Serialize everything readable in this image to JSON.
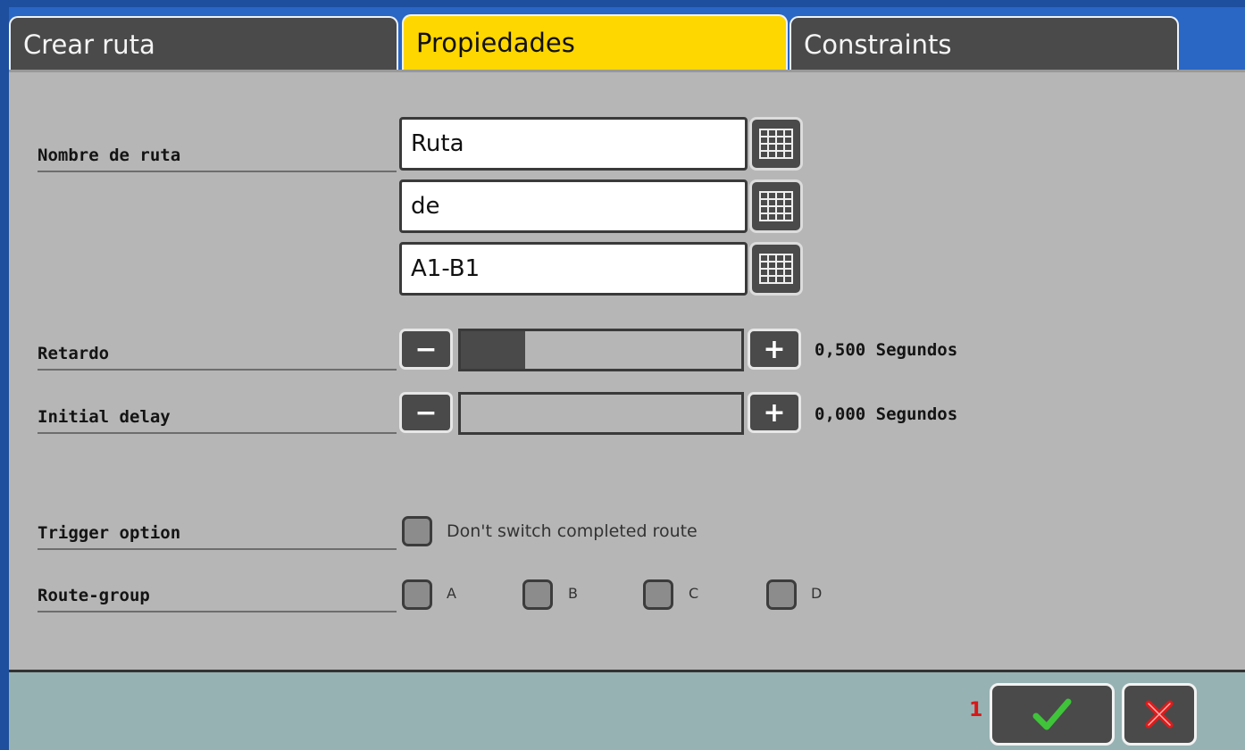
{
  "tabs": [
    {
      "label": "Crear ruta",
      "active": false
    },
    {
      "label": "Propiedades",
      "active": true
    },
    {
      "label": "Constraints",
      "active": false
    }
  ],
  "form": {
    "route_name_label": "Nombre de ruta",
    "route_name_fields": [
      "Ruta",
      "de",
      "A1-B1"
    ],
    "keyboard_icon": "keyboard-icon",
    "delay_label": "Retardo",
    "delay_value_text": "0,500 Segundos",
    "delay_fraction": 0.23,
    "initial_delay_label": "Initial delay",
    "initial_delay_value_text": "0,000 Segundos",
    "initial_delay_fraction": 0.0,
    "minus_symbol": "−",
    "plus_symbol": "+",
    "trigger_label": "Trigger option",
    "trigger_option_text": "Don't switch completed route",
    "route_group_label": "Route-group",
    "route_groups": [
      "A",
      "B",
      "C",
      "D"
    ]
  },
  "footer": {
    "count": "1",
    "confirm_icon": "checkmark-icon",
    "cancel_icon": "close-icon"
  },
  "colors": {
    "active_tab": "#ffd700",
    "inactive_tab": "#4a4a4a",
    "panel": "#b6b6b6",
    "footer": "#97b2b3",
    "confirm": "#3fc43a",
    "cancel": "#e01b1b"
  }
}
